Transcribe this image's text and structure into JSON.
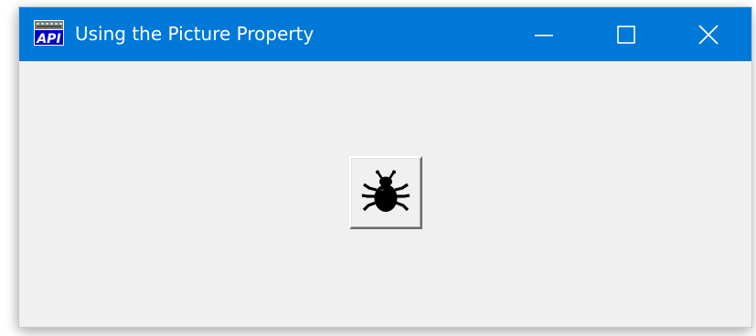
{
  "window": {
    "title": "Using the Picture Property",
    "app_icon_text": "API",
    "titlebar_color": "#0078d7",
    "client_background": "#f0f0f0"
  },
  "titlebar_buttons": {
    "minimize_icon": "minimize-icon",
    "maximize_icon": "maximize-icon",
    "close_icon": "close-icon"
  },
  "picture_button": {
    "icon": "bug-icon"
  }
}
